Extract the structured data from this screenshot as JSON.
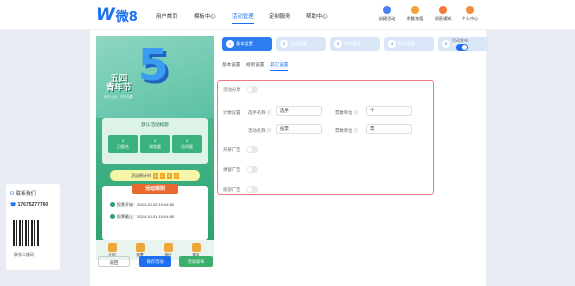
{
  "header": {
    "logo_mark": "W",
    "logo_text": "微8",
    "nav": [
      "用户首页",
      "模板中心",
      "活动管理",
      "定制服务",
      "帮助中心"
    ],
    "icons": [
      {
        "label": "创建活动",
        "icon": "ghost-icon"
      },
      {
        "label": "余额充值",
        "icon": "coin-icon"
      },
      {
        "label": "消息通知",
        "icon": "bell-icon"
      },
      {
        "label": "个人中心",
        "icon": "user-icon"
      }
    ]
  },
  "phone": {
    "big_num": "5",
    "festival": "五四\n青年节",
    "fest_sub": "永不止步，不负青春",
    "card_title": "默认活动标题",
    "stats": [
      {
        "v": "0",
        "l": "已报名"
      },
      {
        "v": "0",
        "l": "浏览量"
      },
      {
        "v": "0",
        "l": "访问量"
      }
    ],
    "countdown": [
      "活动倒计时",
      "0",
      "0",
      "0",
      "0"
    ],
    "rules_title": "活动规则",
    "start": "投票开始：2024-10-20 10:04:50",
    "end": "投票截止：2024-10-31 10:04:50",
    "tabbar": [
      "介绍",
      "投票",
      "排行",
      "报名"
    ]
  },
  "buttons": {
    "prev": "返回",
    "save": "保存活动",
    "publish": "活动发布"
  },
  "steps": [
    {
      "n": "1",
      "label": "基本设置"
    },
    {
      "n": "2",
      "label": "页面设置"
    },
    {
      "n": "3",
      "label": "选手管理"
    },
    {
      "n": "4",
      "label": "报名设置"
    },
    {
      "n": "5",
      "label": "投票统计"
    }
  ],
  "active_status_label": "活动发布",
  "tabs": [
    "基本设置",
    "规则设置",
    "其它设置"
  ],
  "form": {
    "activity_share": "活动分享",
    "counts": "计数设置",
    "f1": "选手名称 ⓘ",
    "v1": "选手",
    "f2": "票数单位 ⓘ",
    "v2": "个",
    "f3": "活动名称 ⓘ",
    "v3": "投票",
    "f4": "票数单位 ⓘ",
    "v4": "票",
    "ad_top": "开屏广告",
    "ad_bottom": "弹窗广告",
    "ad_float": "底部广告"
  },
  "side": {
    "contact": "联系我们",
    "phone": "17675277760",
    "qr_label": "联系二维码"
  }
}
